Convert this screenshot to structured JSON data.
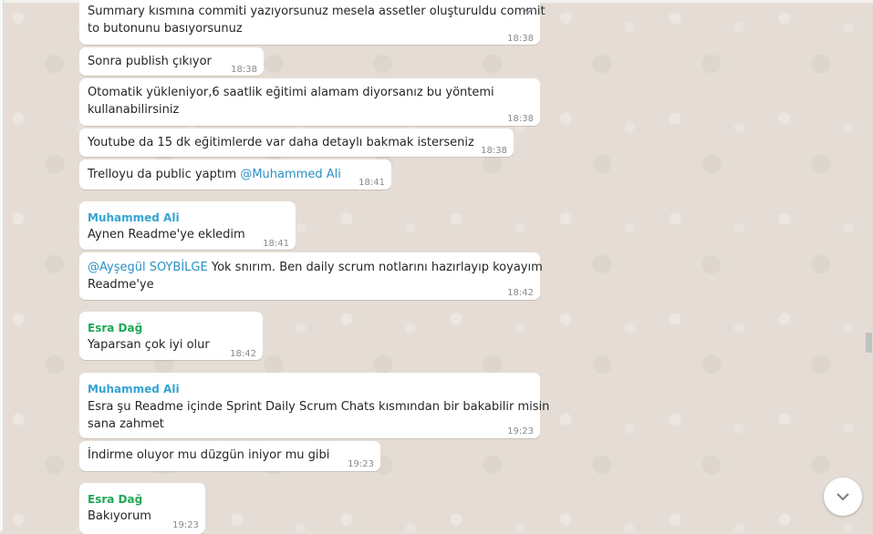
{
  "colors": {
    "bubble_bg": "#ffffff",
    "sender_blue": "#35a3d4",
    "sender_green": "#1fa855",
    "mention": "#2b90c4",
    "timestamp": "#8a8a8a",
    "wallpaper": "#e5ddd5"
  },
  "icons": {
    "message_menu": "chevron-down-icon",
    "scroll_down": "chevron-down-icon"
  },
  "messages": [
    {
      "lines": [
        "Summary kısmına commiti yazıyorsunuz mesela assetler oluşturuldu commit",
        "to butonunu basıyorsunuz"
      ],
      "time": "18:38"
    },
    {
      "lines": [
        "Sonra publish çıkıyor"
      ],
      "time": "18:38"
    },
    {
      "lines": [
        "Otomatik yükleniyor,6 saatlik eğitimi alamam diyorsanız bu yöntemi",
        "kullanabilirsiniz"
      ],
      "time": "18:38"
    },
    {
      "lines": [
        "Youtube da 15 dk eğitimlerde var daha detaylı bakmak isterseniz"
      ],
      "time": "18:38"
    },
    {
      "text": "Trelloyu da public yaptım ",
      "mention": "@Muhammed Ali",
      "time": "18:41"
    },
    {
      "sender": "Muhammed Ali",
      "lines": [
        "Aynen Readme'ye ekledim"
      ],
      "time": "18:41"
    },
    {
      "mention": "@Ayşegül SOYBİLGE",
      "text": " Yok snırım. Ben daily scrum notlarını hazırlayıp koyayım",
      "line2": "Readme'ye",
      "time": "18:42"
    },
    {
      "sender": "Esra Dağ",
      "lines": [
        "Yaparsan çok iyi olur"
      ],
      "time": "18:42"
    },
    {
      "sender": "Muhammed Ali",
      "lines": [
        "Esra şu Readme içinde Sprint Daily Scrum Chats kısmından bir bakabilir misin",
        "sana zahmet"
      ],
      "time": "19:23"
    },
    {
      "lines": [
        "İndirme oluyor mu düzgün iniyor mu gibi"
      ],
      "time": "19:23"
    },
    {
      "sender": "Esra Dağ",
      "lines": [
        "Bakıyorum"
      ],
      "time": "19:23"
    }
  ]
}
